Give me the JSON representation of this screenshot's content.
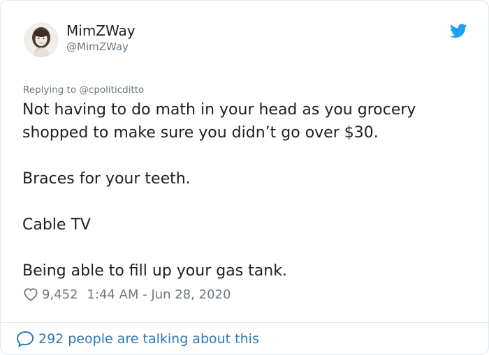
{
  "author": {
    "display_name": "MimZWay",
    "handle": "@MimZWay"
  },
  "icons": {
    "platform": "twitter-bird-icon",
    "like": "heart-icon",
    "conversation": "speech-bubble-icon"
  },
  "reply": {
    "prefix": "Replying to",
    "mention": "@cpoliticditto"
  },
  "tweet": {
    "lines": [
      "Not having to do math in your head as you grocery",
      "shopped to make sure you didn’t go over $30.",
      "Braces for your teeth.",
      "Cable TV",
      "Being able to fill up your gas tank."
    ]
  },
  "meta": {
    "likes": "9,452",
    "timestamp": "1:44 AM - Jun 28, 2020"
  },
  "footer": {
    "conversation_label": "292 people are talking about this"
  },
  "colors": {
    "brand": "#1da1f2",
    "link": "#2b7bb9",
    "muted": "#697882",
    "text": "#1c2022"
  }
}
